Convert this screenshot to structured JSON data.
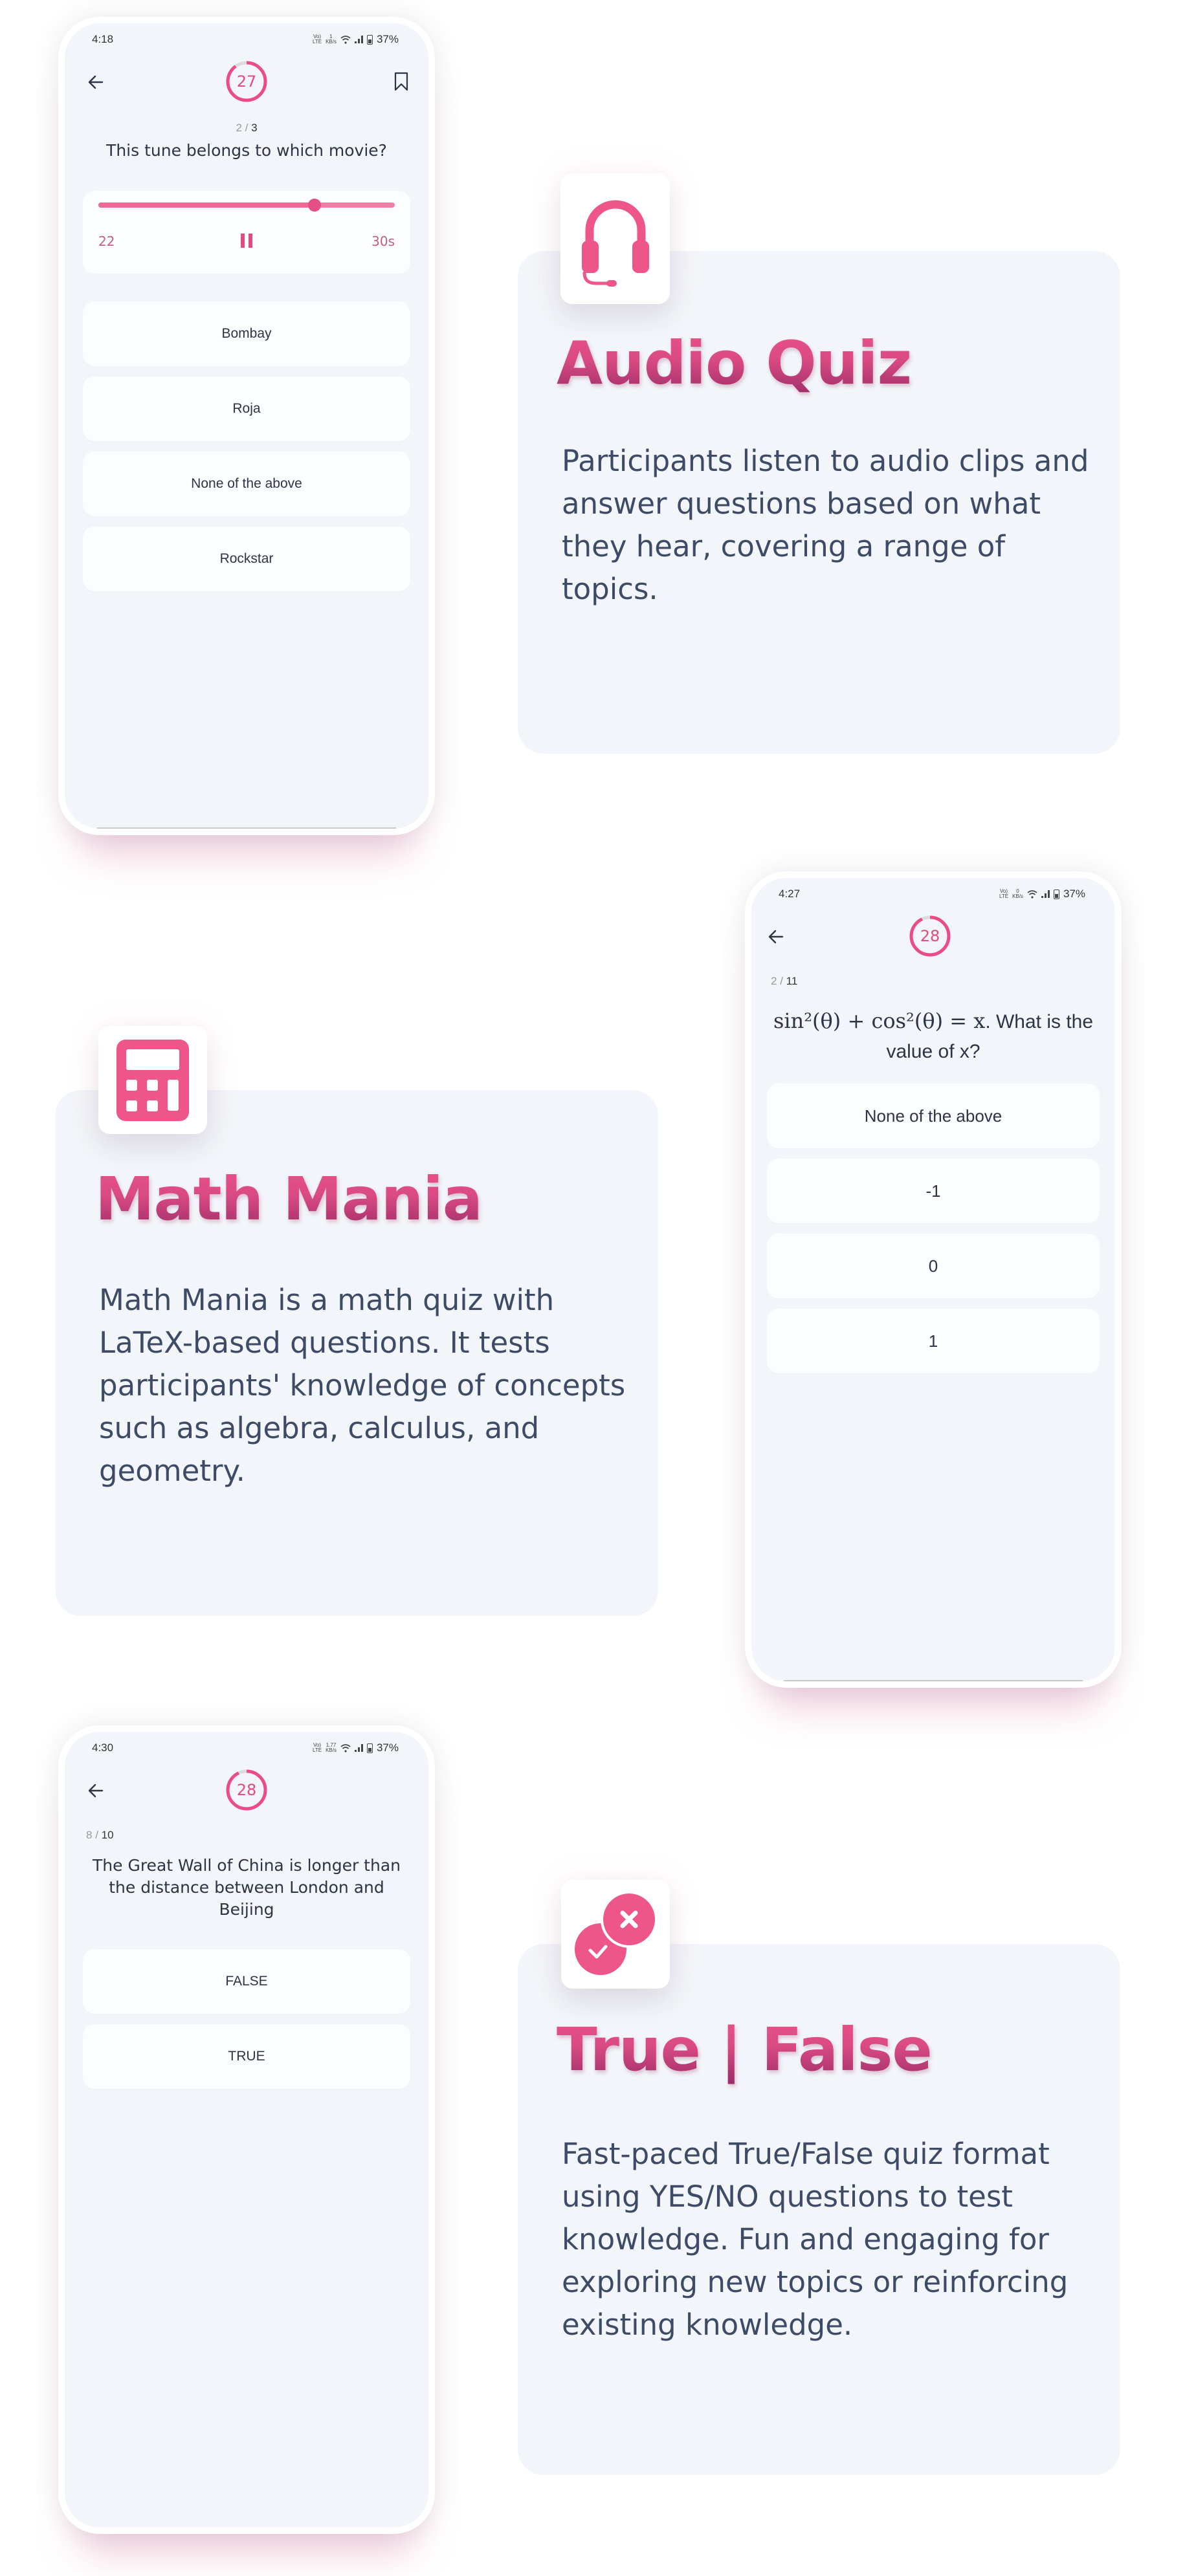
{
  "theme": {
    "accent": "#e94c86",
    "accent_dark": "#9a2c66",
    "card_bg": "#f2f5f9",
    "text": "#2d3446"
  },
  "phones": [
    {
      "status": {
        "time": "4:18",
        "net_top": "Vo)) LTE",
        "speed": "1",
        "speed_unit": "KB/s",
        "battery": "37%"
      },
      "timer": {
        "value": "27",
        "fraction_remaining": 0.9
      },
      "counter": {
        "current": "2",
        "total": "3"
      },
      "question": "This tune belongs to which movie?",
      "audio_player": {
        "current": "22",
        "total": "30s",
        "progress": 0.73
      },
      "options": [
        "Bombay",
        "Roja",
        "None of the above",
        "Rockstar"
      ],
      "icons": {
        "back": "arrow-left-icon",
        "bookmark": "bookmark-icon",
        "pause": "pause-icon"
      }
    },
    {
      "status": {
        "time": "4:27",
        "net_top": "Vo)) LTE",
        "speed": "0",
        "speed_unit": "KB/s",
        "battery": "37%"
      },
      "timer": {
        "value": "28",
        "fraction_remaining": 0.93
      },
      "counter": {
        "current": "2",
        "total": "11"
      },
      "question_math": "sin²(θ) + cos²(θ) = x",
      "question": ". What is the value of x?",
      "options": [
        "None of the above",
        "-1",
        "0",
        "1"
      ],
      "icons": {
        "back": "arrow-left-icon"
      }
    },
    {
      "status": {
        "time": "4:30",
        "net_top": "Vo)) LTE",
        "speed": "1.77",
        "speed_unit": "KB/s",
        "battery": "37%"
      },
      "timer": {
        "value": "28",
        "fraction_remaining": 0.93
      },
      "counter": {
        "current": "8",
        "total": "10"
      },
      "question": "The Great Wall of China is longer than the distance between London and Beijing",
      "options": [
        "FALSE",
        "TRUE"
      ],
      "icons": {
        "back": "arrow-left-icon"
      }
    }
  ],
  "features": [
    {
      "icon": "headset-icon",
      "title": "Audio Quiz",
      "description": "Participants listen to audio clips and answer questions based on what they hear, covering a range of topics."
    },
    {
      "icon": "calculator-icon",
      "title": "Math Mania",
      "description": "Math Mania is a math quiz with LaTeX-based questions. It tests participants' knowledge of concepts such as algebra, calculus, and geometry."
    },
    {
      "icon": "true-false-icon",
      "title": "True | False",
      "description": "Fast-paced True/False quiz format using YES/NO questions to test knowledge. Fun and engaging for exploring new topics or reinforcing existing knowledge."
    }
  ]
}
